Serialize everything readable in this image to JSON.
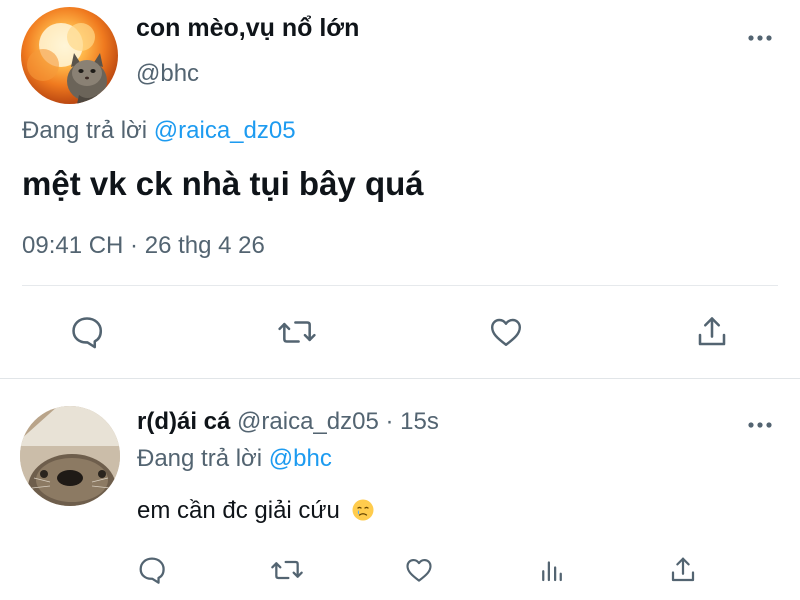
{
  "main_tweet": {
    "display_name": "con mèo,vụ nổ lớn",
    "handle": "@bhc",
    "replying_to_label": "Đang trả lời",
    "replying_to_handle": "@raica_dz05",
    "text": "mệt vk ck nhà tụi bây quá",
    "timestamp": "09:41 CH · 26 thg 4 26",
    "actions": [
      "reply-icon",
      "retweet-icon",
      "like-icon",
      "share-icon"
    ]
  },
  "reply_tweet": {
    "display_name": "r(d)ái cá",
    "handle": "@raica_dz05",
    "separator": "·",
    "time": "15s",
    "replying_to_label": "Đang trả lời",
    "replying_to_handle": "@bhc",
    "text": "em cần đc giải cứu",
    "emoji": "crying-face-emoji",
    "actions": [
      "reply-icon",
      "retweet-icon",
      "like-icon",
      "analytics-icon",
      "share-icon"
    ]
  },
  "colors": {
    "text_primary": "#0f1419",
    "text_secondary": "#536471",
    "accent": "#1d9bf0",
    "divider": "#e6e9ec"
  }
}
